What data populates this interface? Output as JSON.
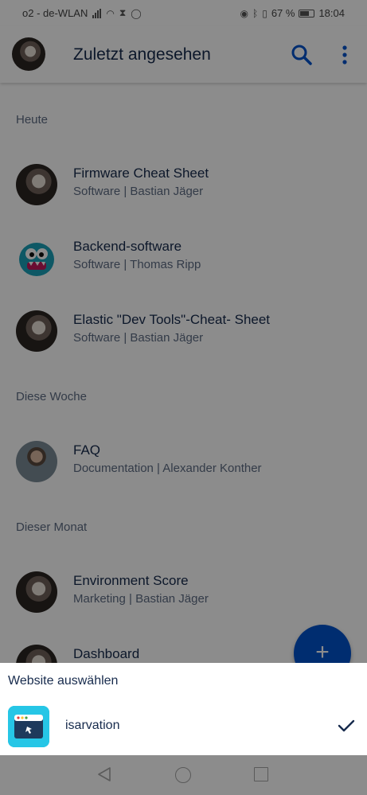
{
  "status_bar": {
    "carrier": "o2 - de-WLAN",
    "battery_percent": "67 %",
    "time": "18:04",
    "icons": [
      "signal-icon",
      "wifi-icon",
      "hourglass-icon",
      "whatsapp-icon",
      "eye-icon",
      "bluetooth-icon",
      "vibrate-icon",
      "battery-icon"
    ]
  },
  "header": {
    "title": "Zuletzt angesehen",
    "icons": [
      "avatar",
      "search-icon",
      "more-vert-icon"
    ]
  },
  "sections": [
    {
      "title": "Heute",
      "items": [
        {
          "title": "Firmware Cheat Sheet",
          "subtitle": "Software | Bastian Jäger"
        },
        {
          "title": "Backend-software",
          "subtitle": "Software | Thomas Ripp"
        },
        {
          "title": "Elastic \"Dev Tools\"-Cheat- Sheet",
          "subtitle": "Software | Bastian Jäger"
        }
      ]
    },
    {
      "title": "Diese Woche",
      "items": [
        {
          "title": "FAQ",
          "subtitle": "Documentation | Alexander Konther"
        }
      ]
    },
    {
      "title": "Dieser Monat",
      "items": [
        {
          "title": "Environment Score",
          "subtitle": "Marketing | Bastian Jäger"
        },
        {
          "title": "Dashboard",
          "subtitle": ""
        }
      ]
    }
  ],
  "fab": {
    "label": "+",
    "icon": "plus-icon"
  },
  "bottom_sheet": {
    "title": "Website auswählen",
    "site": {
      "name": "isarvation",
      "selected": true,
      "icon": "site-logo-icon"
    }
  },
  "nav_bar": {
    "icons": [
      "back-icon",
      "home-icon",
      "recents-icon"
    ]
  },
  "colors": {
    "primary": "#0052cc",
    "text": "#172b4d",
    "subtle": "#5e6c84",
    "logo": "#26c6e6"
  }
}
